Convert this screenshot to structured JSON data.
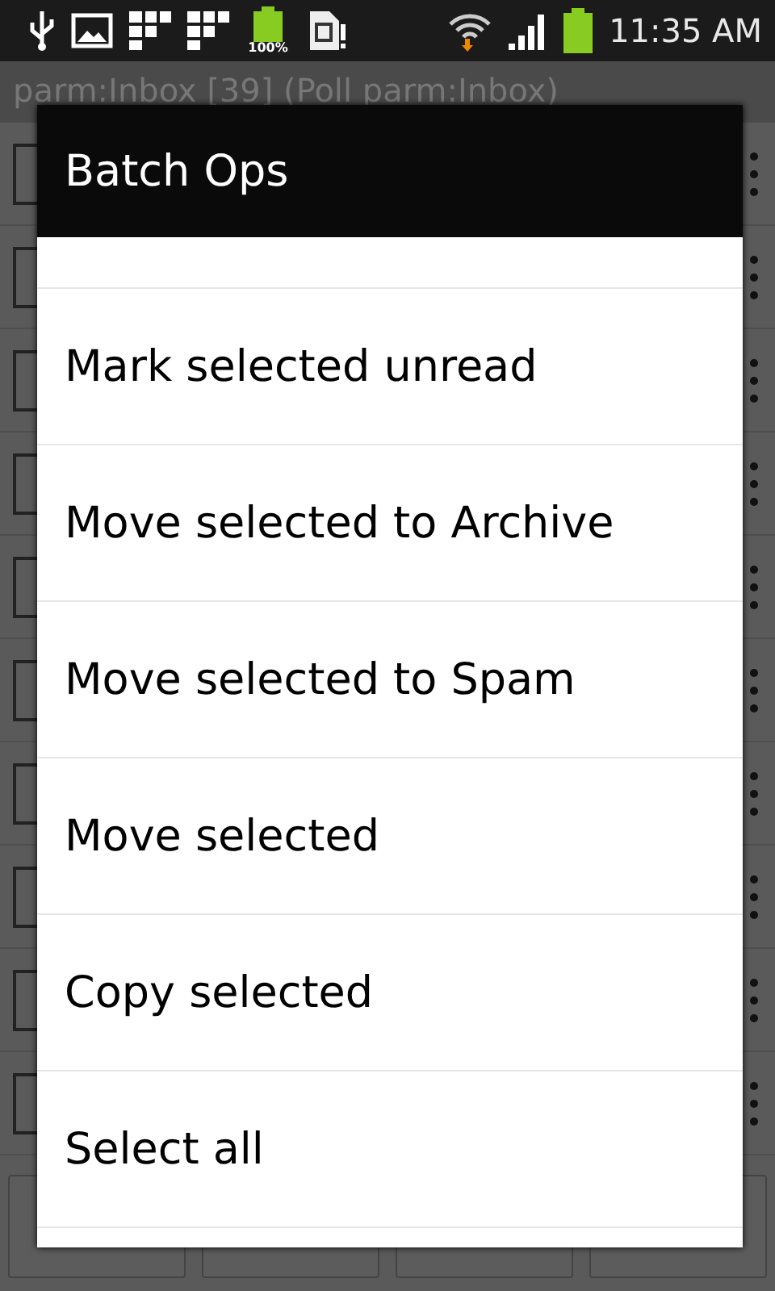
{
  "status_bar": {
    "battery_notice": "100%",
    "time": "11:35 AM"
  },
  "title_bar": {
    "title": "parm:Inbox [39] (Poll parm:Inbox)"
  },
  "messages": [
    {
      "checked": false
    },
    {
      "checked": false
    },
    {
      "checked": false
    },
    {
      "checked": false
    },
    {
      "checked": false
    },
    {
      "checked": false
    },
    {
      "checked": false
    },
    {
      "checked": false
    },
    {
      "checked": false
    },
    {
      "checked": false
    }
  ],
  "dialog": {
    "title": "Batch Ops",
    "items": [
      "Mark selected unread",
      "Move selected to Archive",
      "Move selected to Spam",
      "Move selected",
      "Copy selected",
      "Select all"
    ]
  }
}
